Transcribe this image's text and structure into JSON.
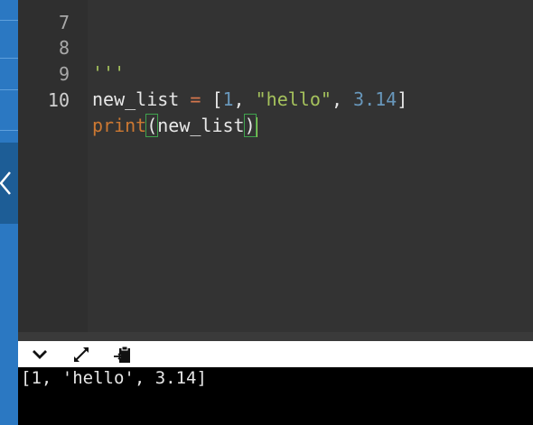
{
  "editor": {
    "lines": [
      {
        "number": "7",
        "text": ""
      },
      {
        "number": "8",
        "text": "'''"
      },
      {
        "number": "9",
        "parts": [
          "new_list",
          " = ",
          "[",
          "1",
          ", ",
          "\"hello\"",
          ", ",
          "3.14",
          "]"
        ]
      },
      {
        "number": "10",
        "parts": [
          "print",
          "(",
          "new_list",
          ")"
        ]
      }
    ],
    "active_line": "10"
  },
  "console": {
    "output": "[1, 'hello', 3.14]",
    "icons": [
      "chevron-down-icon",
      "expand-icon",
      "paste-icon"
    ]
  },
  "colors": {
    "editor_bg": "#333333",
    "gutter_bg": "#2f2f2f",
    "string": "#a5c25c",
    "number": "#6897bb",
    "keyword": "#cc7832",
    "sidebar": "#2b78c2",
    "console_bg": "#000000"
  }
}
